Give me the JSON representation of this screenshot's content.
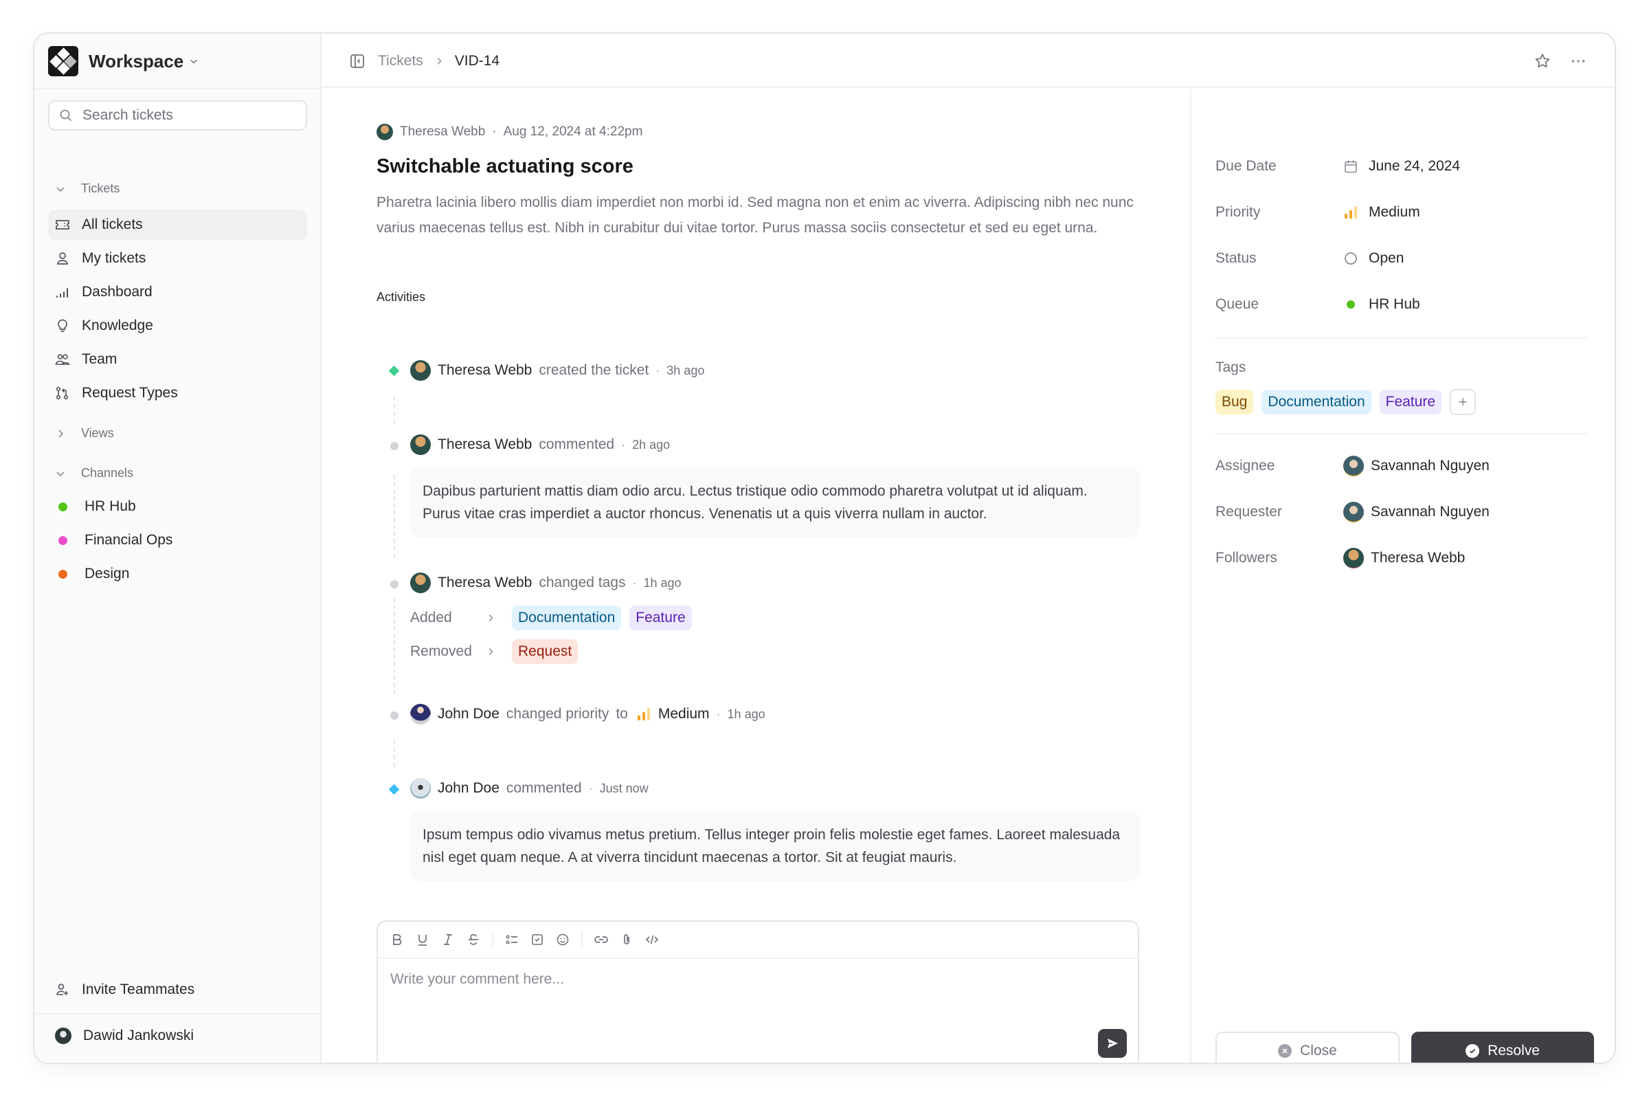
{
  "workspace": {
    "name": "Workspace"
  },
  "search": {
    "placeholder": "Search tickets",
    "value": ""
  },
  "sidebar": {
    "tickets_header": "Tickets",
    "items": [
      {
        "label": "All tickets",
        "icon": "ticket-icon",
        "active": true
      },
      {
        "label": "My tickets",
        "icon": "user-icon"
      },
      {
        "label": "Dashboard",
        "icon": "bar-chart-icon"
      },
      {
        "label": "Knowledge",
        "icon": "lightbulb-icon"
      },
      {
        "label": "Team",
        "icon": "users-icon"
      },
      {
        "label": "Request Types",
        "icon": "git-compare-icon"
      }
    ],
    "views_header": "Views",
    "channels_header": "Channels",
    "channels": [
      {
        "label": "HR Hub",
        "color": "#52c41a"
      },
      {
        "label": "Financial Ops",
        "color": "#e94fc7"
      },
      {
        "label": "Design",
        "color": "#f06b1f"
      }
    ],
    "invite_label": "Invite Teammates",
    "current_user": "Dawid Jankowski"
  },
  "header": {
    "breadcrumb_parent": "Tickets",
    "breadcrumb_current": "VID-14"
  },
  "ticket": {
    "author": "Theresa Webb",
    "created_at": "Aug 12, 2024 at 4:22pm",
    "title": "Switchable actuating score",
    "description": "Pharetra lacinia libero mollis diam imperdiet non morbi id. Sed magna non et enim ac viverra. Adipiscing nibh nec nunc varius maecenas tellus est. Nibh in curabitur dui vitae tortor. Purus massa sociis consectetur et sed eu eget urna."
  },
  "activities": {
    "label": "Activities",
    "items": [
      {
        "user": "Theresa Webb",
        "action": "created the ticket",
        "time": "3h ago",
        "marker_color": "#3ecf8e"
      },
      {
        "user": "Theresa Webb",
        "action": "commented",
        "time": "2h ago",
        "comment": "Dapibus parturient mattis diam odio arcu. Lectus tristique odio commodo pharetra volutpat ut id aliquam. Purus vitae cras imperdiet a auctor rhoncus. Venenatis ut a quis viverra nullam in auctor."
      },
      {
        "user": "Theresa Webb",
        "action": "changed tags",
        "time": "1h ago",
        "added_label": "Added",
        "added": [
          "Documentation",
          "Feature"
        ],
        "removed_label": "Removed",
        "removed": [
          "Request"
        ]
      },
      {
        "user": "John Doe",
        "action": "changed priority",
        "to": "to",
        "value": "Medium",
        "time": "1h ago"
      },
      {
        "user": "John Doe",
        "action": "commented",
        "time": "Just now",
        "marker_color": "#38bdf8",
        "comment": "Ipsum tempus odio vivamus metus pretium. Tellus integer proin felis molestie eget fames. Laoreet malesuada nisl eget quam neque. A at viverra tincidunt maecenas a tortor. Sit at feugiat mauris."
      }
    ]
  },
  "editor": {
    "placeholder": "Write your comment here...",
    "toolbar": [
      "bold",
      "underline",
      "italic",
      "strikethrough",
      "bullet-list",
      "checklist",
      "emoji",
      "link",
      "attachment",
      "code"
    ]
  },
  "details": {
    "due_date_label": "Due Date",
    "due_date": "June 24, 2024",
    "priority_label": "Priority",
    "priority": "Medium",
    "status_label": "Status",
    "status": "Open",
    "queue_label": "Queue",
    "queue": "HR Hub",
    "queue_color": "#52c41a",
    "tags_label": "Tags",
    "tags": [
      "Bug",
      "Documentation",
      "Feature"
    ],
    "add_tag": "+",
    "assignee_label": "Assignee",
    "assignee": "Savannah Nguyen",
    "requester_label": "Requester",
    "requester": "Savannah Nguyen",
    "followers_label": "Followers",
    "followers": "Theresa Webb"
  },
  "actions": {
    "close_label": "Close",
    "resolve_label": "Resolve"
  }
}
